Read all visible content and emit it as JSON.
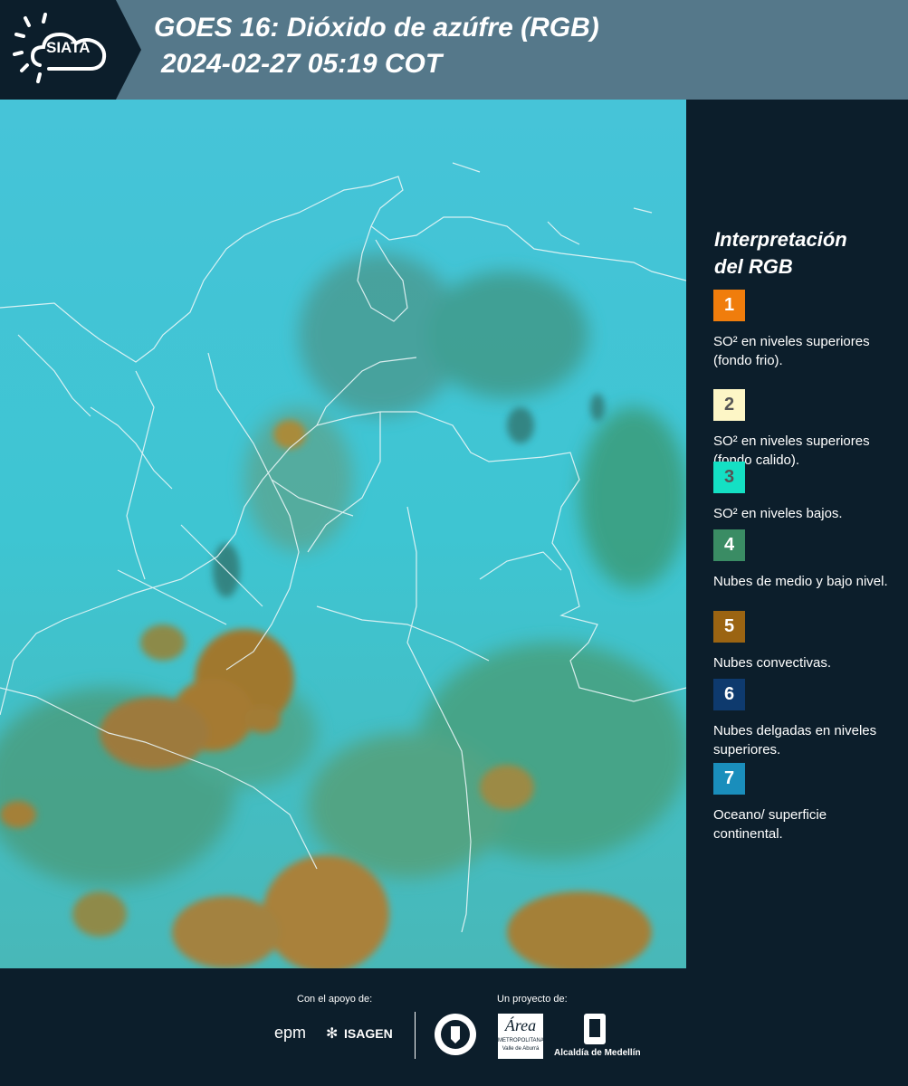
{
  "header": {
    "logo_text": "SIATA",
    "title": "GOES 16: Dióxido de azúfre (RGB)",
    "subtitle": "2024-02-27 05:19 COT"
  },
  "legend": {
    "title_line1": "Interpretación",
    "title_line2": "del RGB",
    "items": [
      {
        "number": "1",
        "color": "#f07d0c",
        "number_color": "#ffffff",
        "text": "SO² en niveles superiores (fondo frio)."
      },
      {
        "number": "2",
        "color": "#fdf6c6",
        "number_color": "#555555",
        "text": "SO² en niveles superiores (fondo calido)."
      },
      {
        "number": "3",
        "color": "#14e0c4",
        "number_color": "#555555",
        "text": "SO² en niveles bajos."
      },
      {
        "number": "4",
        "color": "#3a8c64",
        "number_color": "#ffffff",
        "text": "Nubes de medio y bajo nivel."
      },
      {
        "number": "5",
        "color": "#9b6412",
        "number_color": "#ffffff",
        "text": "Nubes convectivas."
      },
      {
        "number": "6",
        "color": "#0e3a6e",
        "number_color": "#ffffff",
        "text": "Nubes delgadas en niveles superiores."
      },
      {
        "number": "7",
        "color": "#1a8ebc",
        "number_color": "#ffffff",
        "text": "Oceano/ superficie continental."
      }
    ]
  },
  "footer": {
    "support_label": "Con el apoyo de:",
    "project_label": "Un proyecto de:",
    "sponsor_epm": "epm",
    "sponsor_isagen": "ISAGEN",
    "partner_area_line1": "Área",
    "partner_area_line2": "METROPOLITANA",
    "partner_area_line3": "Valle de Aburrá",
    "partner_medellin": "Alcaldía de Medellín"
  }
}
